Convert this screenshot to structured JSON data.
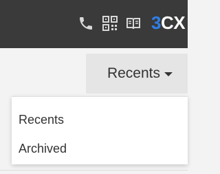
{
  "topbar": {
    "icons": [
      "phone-icon",
      "qr-code-icon",
      "book-icon"
    ],
    "brand": {
      "number": "3",
      "text": "CX",
      "number_color": "#2f7fe6",
      "text_color": "#ffffff"
    },
    "background": "#3a3a3a"
  },
  "filter_dropdown": {
    "selected": "Recents"
  },
  "menu": {
    "items": [
      {
        "label": "Recents"
      },
      {
        "label": "Archived"
      }
    ]
  }
}
